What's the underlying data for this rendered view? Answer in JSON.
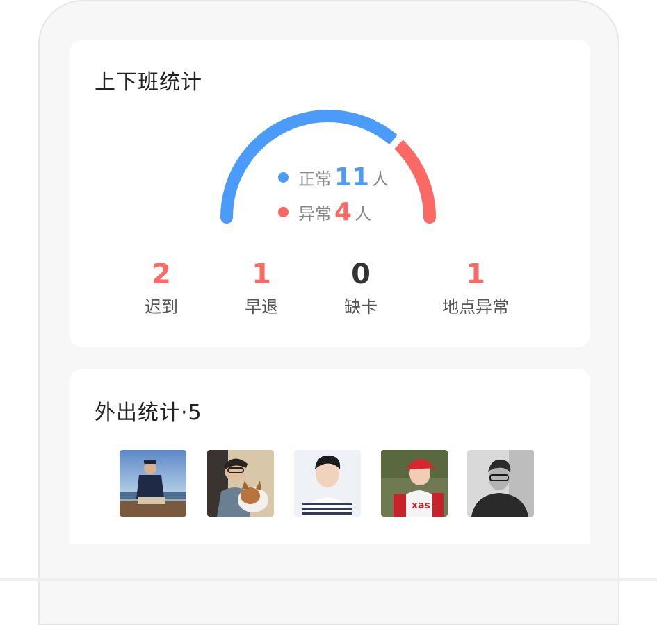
{
  "attendance": {
    "title": "上下班统计",
    "normal": {
      "label": "正常",
      "count": "11",
      "unit": "人"
    },
    "abnormal": {
      "label": "异常",
      "count": "4",
      "unit": "人"
    },
    "stats": [
      {
        "value": "2",
        "label": "迟到"
      },
      {
        "value": "1",
        "label": "早退"
      },
      {
        "value": "0",
        "label": "缺卡"
      },
      {
        "value": "1",
        "label": "地点异常"
      }
    ]
  },
  "outing": {
    "title": "外出统计·5",
    "avatars": [
      "avatar-1",
      "avatar-2",
      "avatar-3",
      "avatar-4",
      "avatar-5"
    ]
  },
  "colors": {
    "normal": "#4a9bfa",
    "abnormal": "#fb6964",
    "zero": "#333333",
    "text": "#222222"
  }
}
